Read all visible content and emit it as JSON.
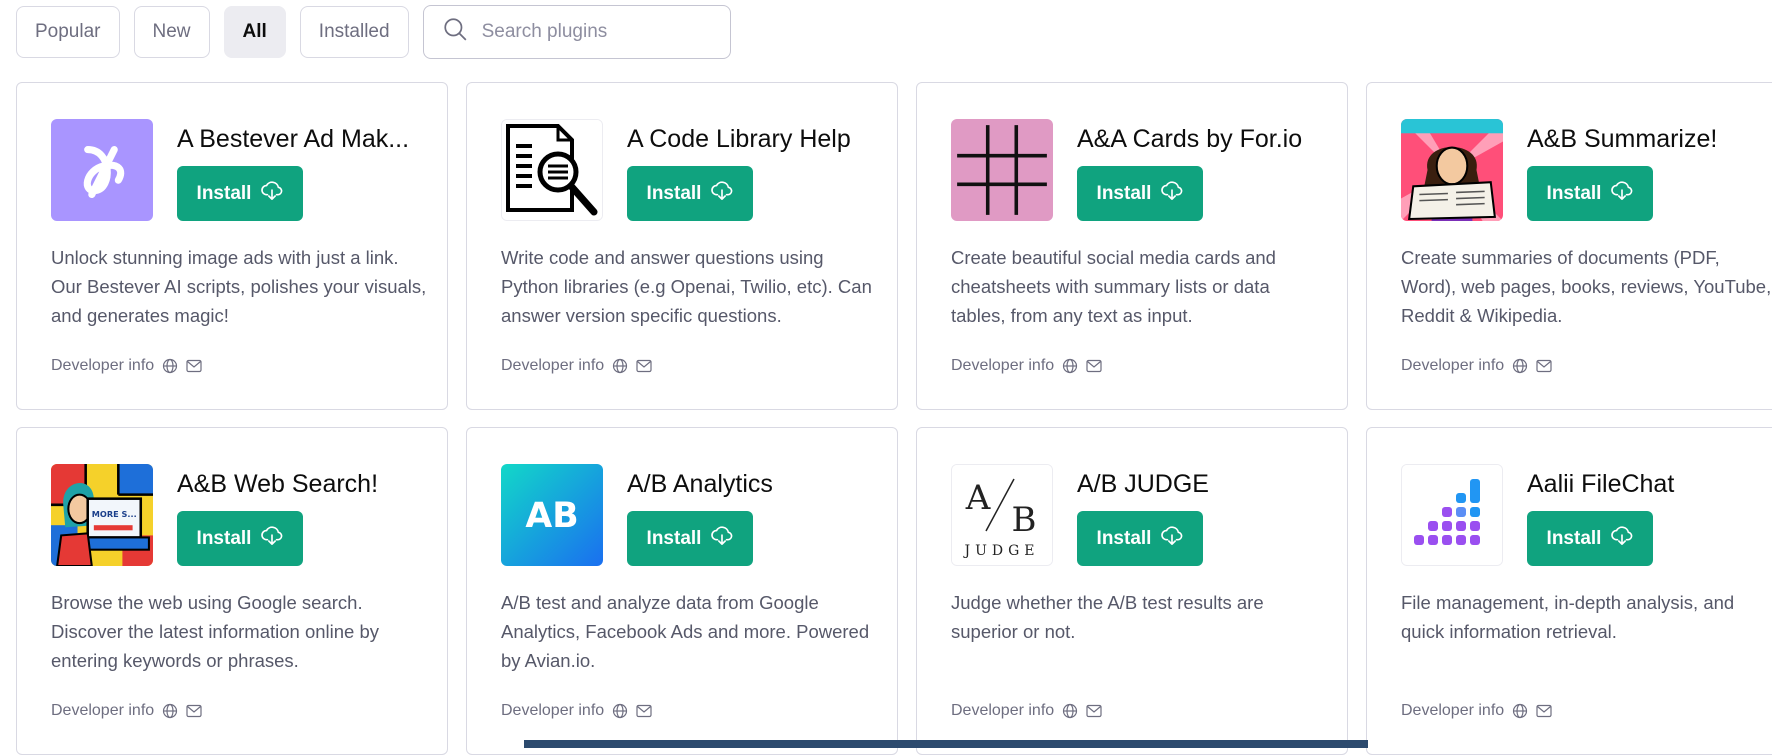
{
  "filters": {
    "tabs": [
      {
        "label": "Popular",
        "active": false
      },
      {
        "label": "New",
        "active": false
      },
      {
        "label": "All",
        "active": true
      },
      {
        "label": "Installed",
        "active": false
      }
    ],
    "search_placeholder": "Search plugins",
    "search_value": ""
  },
  "plugins": [
    {
      "name": "A Bestever Ad Mak...",
      "install_label": "Install",
      "description": "Unlock stunning image ads with just a link. Our Bestever AI scripts, polishes your visuals, and generates magic!",
      "developer_info": "Developer info",
      "icon": "bestever-logo"
    },
    {
      "name": "A Code Library Help",
      "install_label": "Install",
      "description": "Write code and answer questions using Python libraries (e.g Openai, Twilio, etc). Can answer version specific questions.",
      "developer_info": "Developer info",
      "icon": "code-library-logo"
    },
    {
      "name": "A&A Cards by For.io",
      "install_label": "Install",
      "description": "Create beautiful social media cards and cheatsheets with summary lists or data tables, from any text as input.",
      "developer_info": "Developer info",
      "icon": "aa-cards-logo"
    },
    {
      "name": "A&B Summarize!",
      "install_label": "Install",
      "description": "Create summaries of documents (PDF, Word), web pages, books, reviews, YouTube, Reddit & Wikipedia.",
      "developer_info": "Developer info",
      "icon": "ab-summarize-logo"
    },
    {
      "name": "A&B Web Search!",
      "install_label": "Install",
      "description": "Browse the web using Google search. Discover the latest information online by entering keywords or phrases.",
      "developer_info": "Developer info",
      "icon": "ab-web-search-logo"
    },
    {
      "name": "A/B Analytics",
      "install_label": "Install",
      "description": "A/B test and analyze data from Google Analytics, Facebook Ads and more. Powered by Avian.io.",
      "developer_info": "Developer info",
      "icon": "ab-analytics-logo"
    },
    {
      "name": "A/B JUDGE",
      "install_label": "Install",
      "description": "Judge whether the A/B test results are superior or not.",
      "developer_info": "Developer info",
      "icon": "ab-judge-logo"
    },
    {
      "name": "Aalii FileChat",
      "install_label": "Install",
      "description": "File management, in-depth analysis, and quick information retrieval.",
      "developer_info": "Developer info",
      "icon": "aalii-filechat-logo"
    }
  ],
  "logo_text": {
    "ab_analytics": "AB",
    "ab_judge_a": "A",
    "ab_judge_b": "B",
    "ab_judge_word": "JUDGE",
    "web_search_screen": "MORE S..."
  },
  "colors": {
    "install_green": "#10a37f",
    "bestever_purple": "#a995ff",
    "aa_cards_pink": "#e09ac4",
    "aalii_purple": "#9a4ff0",
    "aalii_blue": "#2196f3"
  }
}
